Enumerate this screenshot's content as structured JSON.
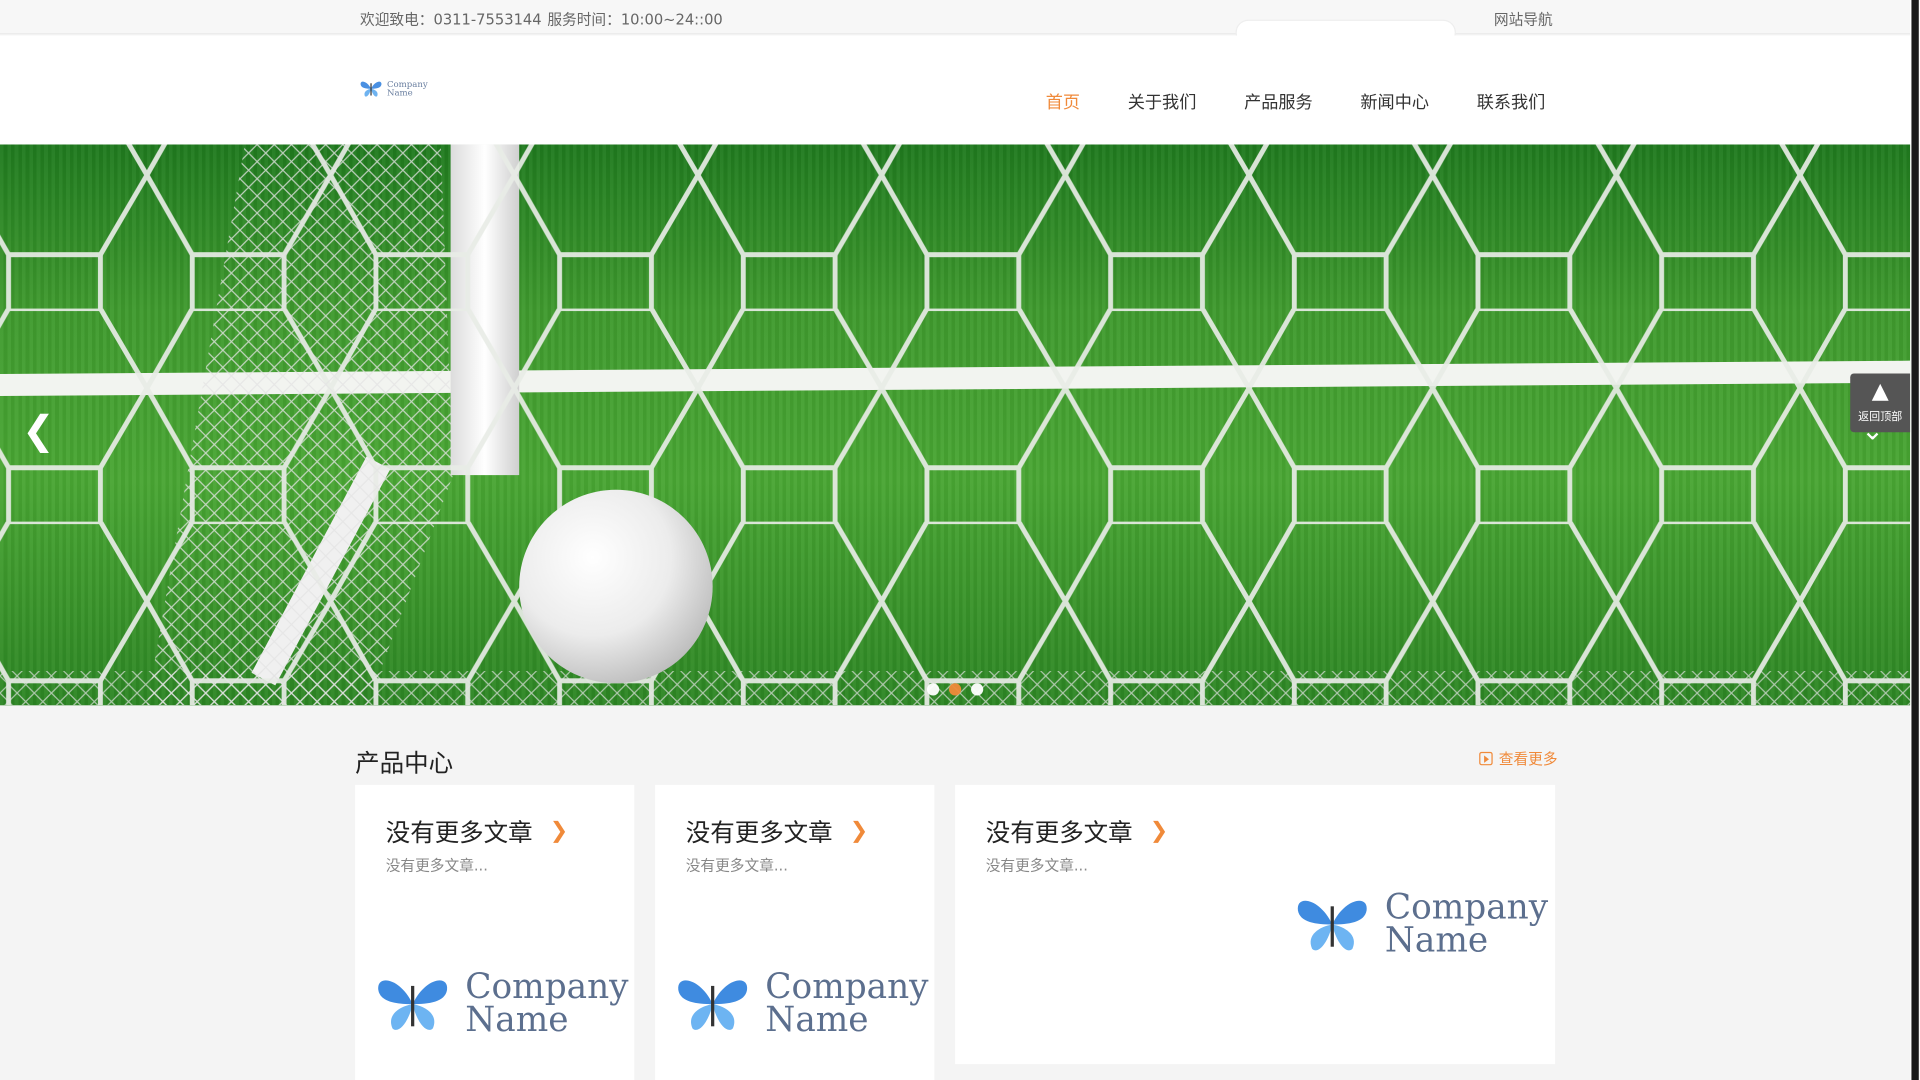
{
  "topbar": {
    "welcome": "欢迎致电：0311-7553144",
    "hours": "服务时间：10:00~24::00",
    "site_nav": "网站导航"
  },
  "header": {
    "logo": {
      "line1": "Company",
      "line2": "Name"
    },
    "nav": [
      "首页",
      "关于我们",
      "产品服务",
      "新闻中心",
      "联系我们"
    ],
    "active_nav": "首页"
  },
  "banner": {
    "prev_icon": "chevron-left-icon",
    "next_icon": "chevron-down-icon",
    "slides": 3,
    "active_slide": 2
  },
  "back_to_top": {
    "icon": "rocket-icon",
    "label": "返回顶部"
  },
  "products": {
    "title": "产品中心",
    "more_label": "查看更多",
    "cards": [
      {
        "title": "没有更多文章",
        "desc": "没有更多文章...",
        "logo_line1": "Company",
        "logo_line2": "Name"
      },
      {
        "title": "没有更多文章",
        "desc": "没有更多文章...",
        "logo_line1": "Company",
        "logo_line2": "Name"
      },
      {
        "title": "没有更多文章",
        "desc": "没有更多文章...",
        "logo_line1": "Company",
        "logo_line2": "Name"
      }
    ]
  },
  "colors": {
    "accent": "#f08a3a",
    "text": "#333333",
    "muted": "#888888",
    "background": "#f4f4f4"
  }
}
